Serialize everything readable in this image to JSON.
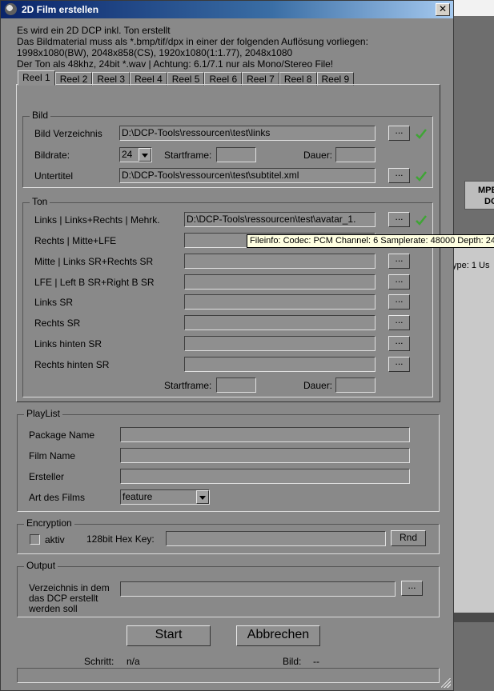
{
  "window": {
    "title": "2D Film erstellen",
    "close_label": "✕"
  },
  "info_lines": [
    "Es wird ein 2D DCP inkl. Ton erstellt",
    "Das Bildmaterial muss als *.bmp/tif/dpx in einer der folgenden Auflösung vorliegen:",
    "1998x1080(BW), 2048x858(CS), 1920x1080(1:1.77), 2048x1080",
    "Der Ton als 48khz, 24bit *.wav  |   Achtung: 6.1/7.1 nur als Mono/Stereo File!"
  ],
  "tabs": [
    "Reel 1",
    "Reel 2",
    "Reel 3",
    "Reel 4",
    "Reel 5",
    "Reel 6",
    "Reel 7",
    "Reel 8",
    "Reel 9"
  ],
  "bild": {
    "group_title": "Bild",
    "verzeichnis_label": "Bild Verzeichnis",
    "verzeichnis_value": "D:\\DCP-Tools\\ressourcen\\test\\links",
    "bildrate_label": "Bildrate:",
    "bildrate_value": "24",
    "startframe_label": "Startframe:",
    "startframe_value": "",
    "dauer_label": "Dauer:",
    "dauer_value": "",
    "untertitel_label": "Untertitel",
    "untertitel_value": "D:\\DCP-Tools\\ressourcen\\test\\subtitel.xml",
    "browse_label": "..."
  },
  "ton": {
    "group_title": "Ton",
    "rows": [
      {
        "label": "Links    | Links+Rechts | Mehrk.",
        "value": "D:\\DCP-Tools\\ressourcen\\test\\avatar_1."
      },
      {
        "label": "Rechts  | Mitte+LFE",
        "value": ""
      },
      {
        "label": "Mitte     | Links SR+Rechts SR",
        "value": ""
      },
      {
        "label": "LFE      | Left B SR+Right B SR",
        "value": ""
      },
      {
        "label": "Links SR",
        "value": ""
      },
      {
        "label": "Rechts SR",
        "value": ""
      },
      {
        "label": "Links hinten SR",
        "value": ""
      },
      {
        "label": "Rechts hinten SR",
        "value": ""
      }
    ],
    "startframe_label": "Startframe:",
    "startframe_value": "",
    "dauer_label": "Dauer:",
    "dauer_value": "",
    "browse_label": "...",
    "tooltip": "Fileinfo: Codec: PCM Channel: 6 Samplerate: 48000 Depth: 24"
  },
  "playlist": {
    "group_title": "PlayList",
    "package_name_label": "Package Name",
    "package_name_value": "",
    "film_name_label": "Film Name",
    "film_name_value": "",
    "ersteller_label": "Ersteller",
    "ersteller_value": "",
    "art_label": "Art des Films",
    "art_value": "feature"
  },
  "encryption": {
    "group_title": "Encryption",
    "aktiv_label": "aktiv",
    "hexkey_label": "128bit Hex Key:",
    "hexkey_value": "",
    "rnd_label": "Rnd"
  },
  "output": {
    "group_title": "Output",
    "verzeichnis_label_1": "Verzeichnis in dem",
    "verzeichnis_label_2": "das DCP erstellt",
    "verzeichnis_label_3": "werden soll",
    "verzeichnis_value": "",
    "browse_label": "..."
  },
  "actions": {
    "start_label": "Start",
    "abbrechen_label": "Abbrechen"
  },
  "status": {
    "schritt_label": "Schritt:",
    "schritt_value": "n/a",
    "bild_label": "Bild:",
    "bild_value": "--"
  },
  "background": {
    "button_line1": "MPE",
    "button_line2": "DC",
    "side_text": "ype: 1 Us"
  },
  "colors": {
    "window_bg": "#898989",
    "titlebar": "#0a246a",
    "check": "#3fa535",
    "tooltip_bg": "#ffffe1"
  }
}
